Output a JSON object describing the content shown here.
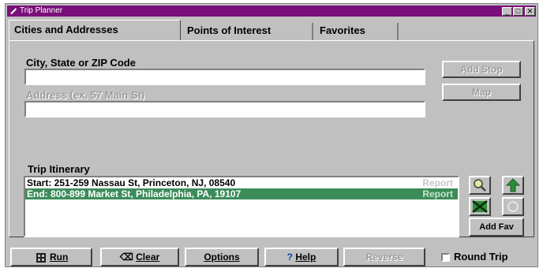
{
  "window": {
    "title": "Trip Planner",
    "controls": [
      "_",
      "□",
      "✕"
    ]
  },
  "tabs": [
    {
      "label": "Cities and Addresses",
      "active": true
    },
    {
      "label": "Points of Interest",
      "active": false
    },
    {
      "label": "Favorites",
      "active": false
    }
  ],
  "city": {
    "label": "City, State or ZIP Code",
    "value": ""
  },
  "address": {
    "label": "Address (ex. 57 Main St)",
    "value": ""
  },
  "side_buttons": {
    "add_stop": "Add Stop",
    "map": "Map"
  },
  "itinerary": {
    "label": "Trip Itinerary",
    "rows": [
      {
        "text": "Start: 251-259 Nassau St, Princeton, NJ, 08540",
        "status": "Report",
        "selected": false
      },
      {
        "text": "End: 800-899 Market St, Philadelphia, PA, 19107",
        "status": "Report",
        "selected": true
      }
    ],
    "add_fav": "Add Fav"
  },
  "bottom": {
    "run": "Run",
    "clear": "Clear",
    "options": "Options",
    "help": "Help",
    "reverse": "Reverse",
    "round_trip": "Round Trip"
  },
  "colors": {
    "titlebar": "#7a0e7a",
    "selection": "#3c8c5a",
    "face": "#c0c0c0"
  }
}
